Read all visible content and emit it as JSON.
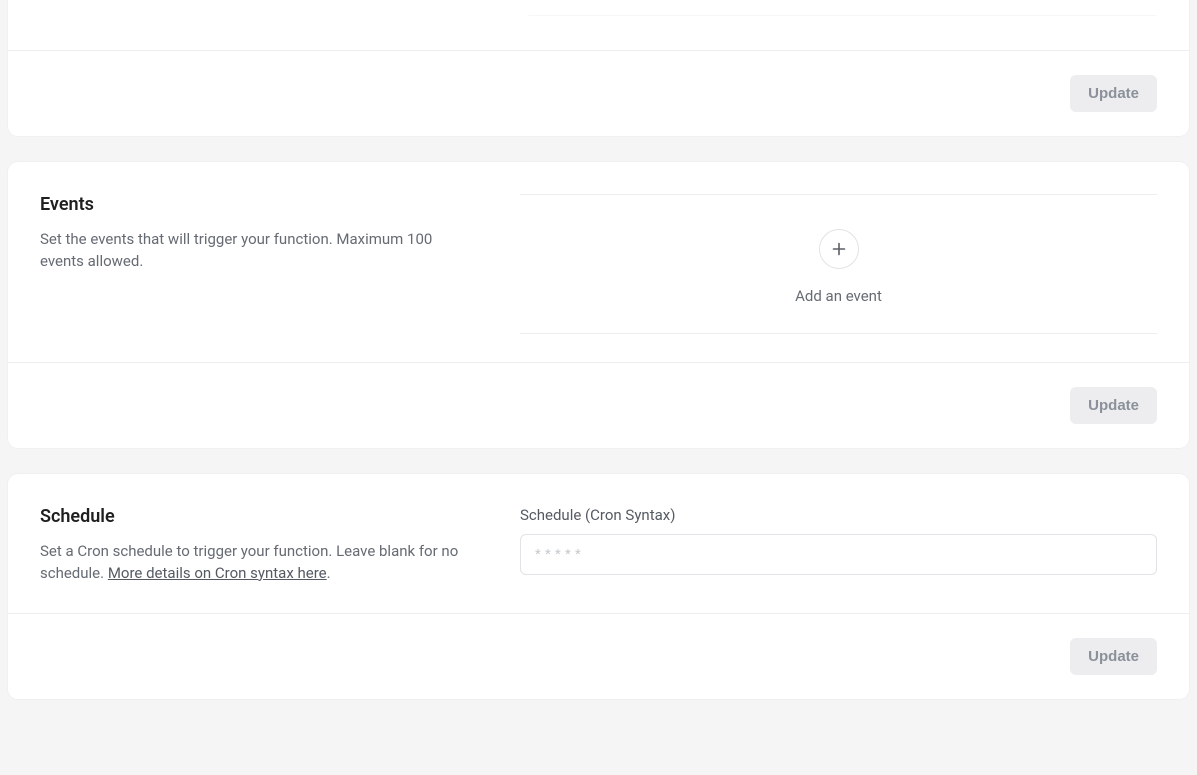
{
  "top_panel": {
    "update_label": "Update"
  },
  "events_panel": {
    "title": "Events",
    "desc": "Set the events that will trigger your function. Maximum 100 events allowed.",
    "add_event_label": "Add an event",
    "update_label": "Update"
  },
  "schedule_panel": {
    "title": "Schedule",
    "desc_prefix": "Set a Cron schedule to trigger your function. Leave blank for no schedule. ",
    "link_text": "More details on Cron syntax here",
    "desc_suffix": ".",
    "field_label": "Schedule (Cron Syntax)",
    "placeholder": "* * * * *",
    "update_label": "Update"
  }
}
